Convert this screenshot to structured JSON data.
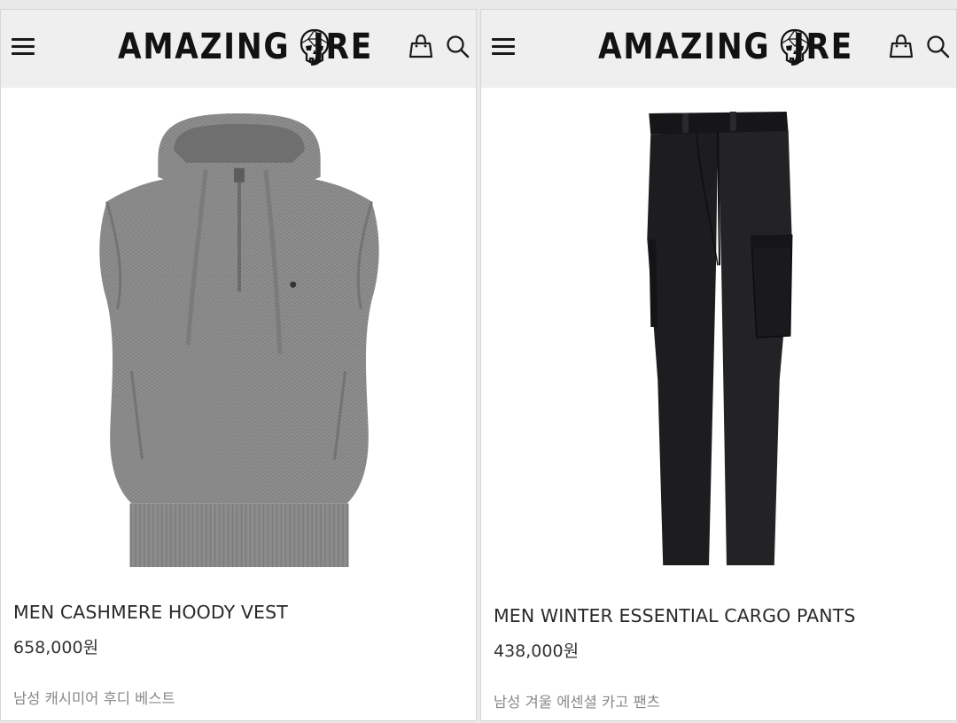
{
  "brand": {
    "logo_left": "AMAZING",
    "logo_right": "JRE"
  },
  "header": {
    "menu_icon": "hamburger-menu-icon",
    "cart_icon": "shopping-bag-icon",
    "search_icon": "search-icon"
  },
  "products": [
    {
      "name": "MEN CASHMERE HOODY VEST",
      "price": "658,000원",
      "subtitle": "남성 캐시미어 후디 베스트",
      "image_icon": "gray-knit-hoody-vest",
      "color": "#8e8e8e"
    },
    {
      "name": "MEN WINTER ESSENTIAL CARGO PANTS",
      "price": "438,000원",
      "subtitle": "남성 겨울 에센셜 카고 팬츠",
      "image_icon": "black-cargo-pants",
      "color": "#1c1c1e"
    }
  ]
}
